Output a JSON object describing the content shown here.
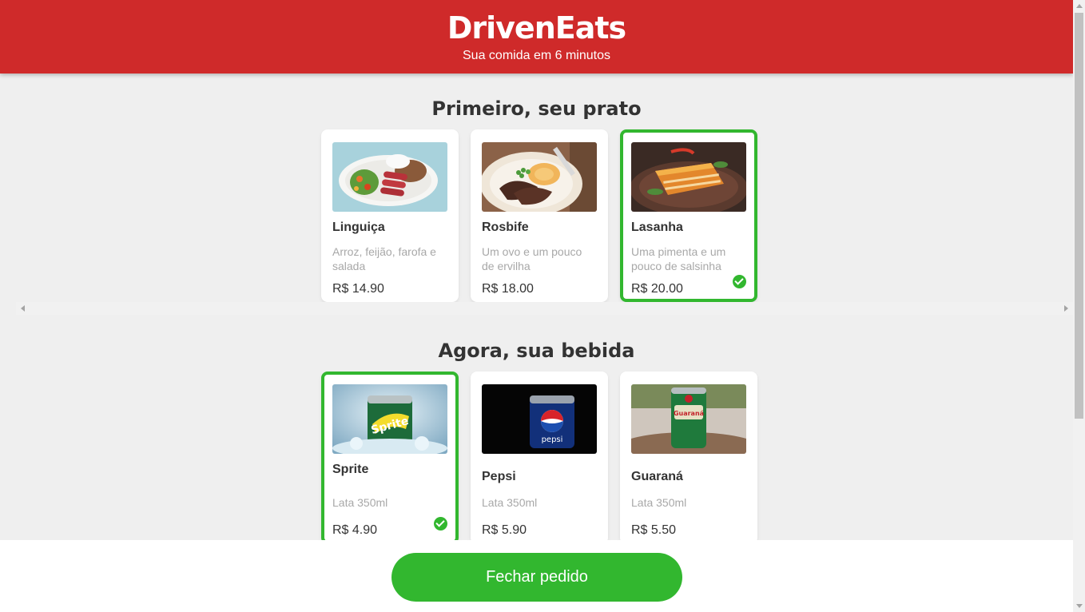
{
  "header": {
    "logo": "DrivenEats",
    "tagline": "Sua comida em 6 minutos"
  },
  "sections": {
    "dishes": {
      "title": "Primeiro, seu prato",
      "items": [
        {
          "name": "Linguiça",
          "desc": "Arroz, feijão, farofa e salada",
          "price": "R$ 14.90",
          "selected": false
        },
        {
          "name": "Rosbife",
          "desc": "Um ovo e um pouco de ervilha",
          "price": "R$ 18.00",
          "selected": false
        },
        {
          "name": "Lasanha",
          "desc": "Uma pimenta e um pouco de salsinha",
          "price": "R$ 20.00",
          "selected": true
        }
      ]
    },
    "drinks": {
      "title": "Agora, sua bebida",
      "items": [
        {
          "name": "Sprite",
          "desc": "Lata 350ml",
          "price": "R$ 4.90",
          "selected": true
        },
        {
          "name": "Pepsi",
          "desc": "Lata 350ml",
          "price": "R$ 5.90",
          "selected": false
        },
        {
          "name": "Guaraná",
          "desc": "Lata 350ml",
          "price": "R$ 5.50",
          "selected": false
        }
      ]
    }
  },
  "footer": {
    "order_button": "Fechar pedido"
  },
  "colors": {
    "brand_red": "#cf2a2a",
    "accent_green": "#32b72f",
    "background": "#efefef"
  }
}
